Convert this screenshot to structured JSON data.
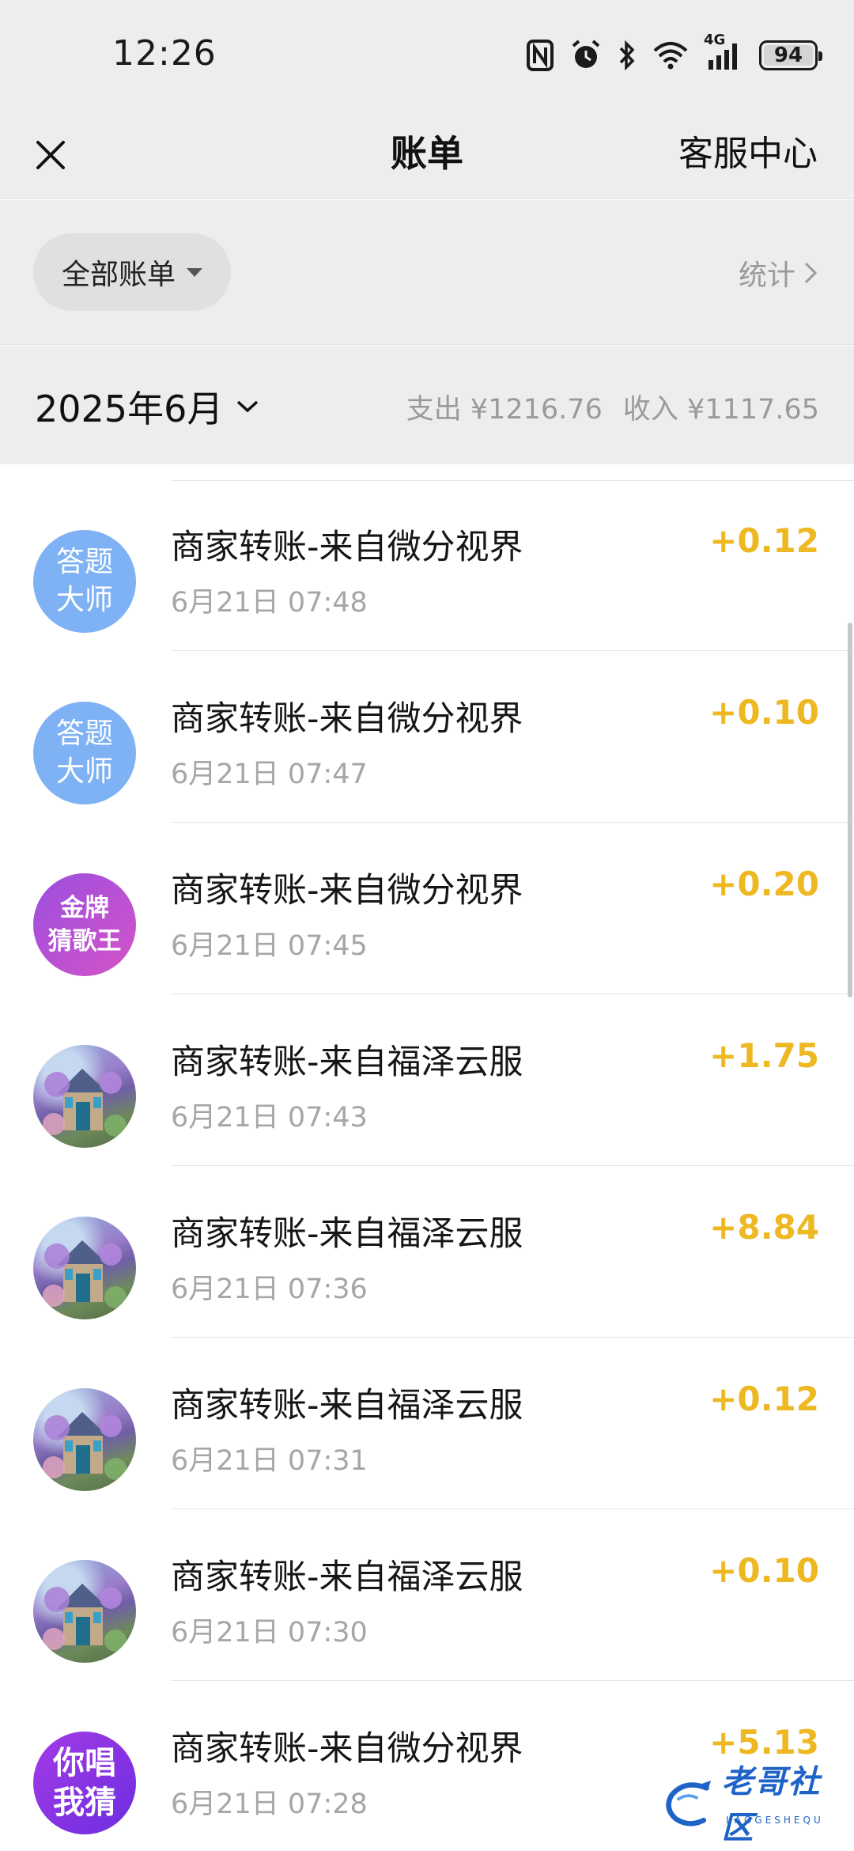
{
  "status_bar": {
    "time": "12:26",
    "network": "4G",
    "battery": "94",
    "icons": [
      "nfc-icon",
      "alarm-icon",
      "bluetooth-icon",
      "wifi-icon",
      "cellular-signal-icon",
      "battery-icon"
    ]
  },
  "header": {
    "title": "账单",
    "close_icon": "close-icon",
    "service_label": "客服中心"
  },
  "filter": {
    "selected_label": "全部账单",
    "stats_label": "统计"
  },
  "month": {
    "label": "2025年6月",
    "expense": "支出 ¥1216.76",
    "income": "收入 ¥1117.65"
  },
  "colors": {
    "amount_income": "#eeb823",
    "background_gray": "#ededed",
    "avatar_quiz": "#7fb2f4"
  },
  "transactions": [
    {
      "avatar_type": "quiz",
      "avatar_text_1": "答题",
      "avatar_text_2": "大师",
      "title": "商家转账-来自微分视界",
      "time": "6月21日 07:48",
      "amount": "+0.12"
    },
    {
      "avatar_type": "quiz",
      "avatar_text_1": "答题",
      "avatar_text_2": "大师",
      "title": "商家转账-来自微分视界",
      "time": "6月21日 07:47",
      "amount": "+0.10"
    },
    {
      "avatar_type": "gold",
      "avatar_text_1": "金牌",
      "avatar_text_2": "猜歌王",
      "title": "商家转账-来自微分视界",
      "time": "6月21日 07:45",
      "amount": "+0.20"
    },
    {
      "avatar_type": "house",
      "title": "商家转账-来自福泽云服",
      "time": "6月21日 07:43",
      "amount": "+1.75"
    },
    {
      "avatar_type": "house",
      "title": "商家转账-来自福泽云服",
      "time": "6月21日 07:36",
      "amount": "+8.84"
    },
    {
      "avatar_type": "house",
      "title": "商家转账-来自福泽云服",
      "time": "6月21日 07:31",
      "amount": "+0.12"
    },
    {
      "avatar_type": "house",
      "title": "商家转账-来自福泽云服",
      "time": "6月21日 07:30",
      "amount": "+0.10"
    },
    {
      "avatar_type": "sing",
      "avatar_text_1": "你唱",
      "avatar_text_2": "我猜",
      "title": "商家转账-来自微分视界",
      "time": "6月21日 07:28",
      "amount": "+5.13"
    }
  ],
  "watermark": {
    "text": "老哥社区",
    "sub": "LAOGESHEQU"
  }
}
